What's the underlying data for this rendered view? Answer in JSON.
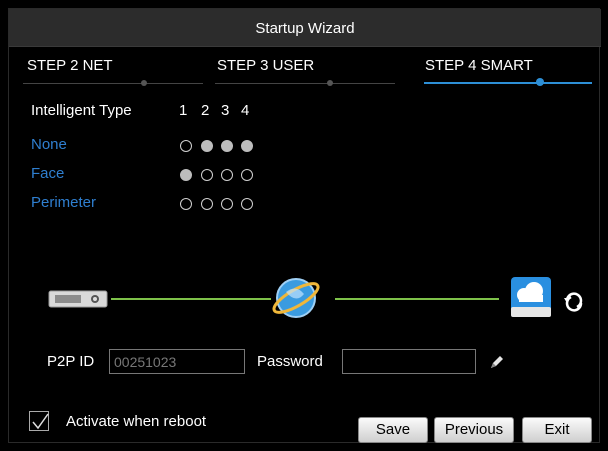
{
  "window": {
    "title": "Startup Wizard"
  },
  "steps": [
    {
      "label": "STEP 2 NET",
      "active": false
    },
    {
      "label": "STEP 3 USER",
      "active": false
    },
    {
      "label": "STEP 4 SMART",
      "active": true
    }
  ],
  "intelligent": {
    "header_label": "Intelligent Type",
    "channels": [
      "1",
      "2",
      "3",
      "4"
    ],
    "rows": [
      {
        "label": "None",
        "selected": [
          false,
          true,
          true,
          true
        ]
      },
      {
        "label": "Face",
        "selected": [
          true,
          false,
          false,
          false
        ]
      },
      {
        "label": "Perimeter",
        "selected": [
          false,
          false,
          false,
          false
        ]
      }
    ]
  },
  "diagram": {
    "device_icon": "dvr-device-icon",
    "internet_icon": "globe-icon",
    "cloud_icon": "cloud-server-icon",
    "refresh_icon": "refresh-icon",
    "line_color": "#7ec24a"
  },
  "p2p": {
    "id_label": "P2P ID",
    "id_value": "00251023",
    "password_label": "Password",
    "password_value": "",
    "edit_icon": "pencil-icon"
  },
  "footer": {
    "activate_label": "Activate when reboot",
    "activate_checked": true,
    "save_label": "Save",
    "previous_label": "Previous",
    "exit_label": "Exit"
  },
  "colors": {
    "accent": "#2d8fd6",
    "row_label": "#2f7fd0",
    "title_bg": "#2c2c2c"
  }
}
